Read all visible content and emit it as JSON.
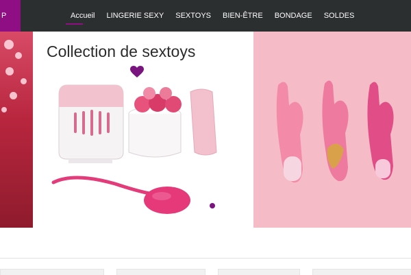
{
  "logo": {
    "label": "P"
  },
  "nav": {
    "items": [
      {
        "label": "Accueil",
        "active": true
      },
      {
        "label": "LINGERIE SEXY"
      },
      {
        "label": "SEXTOYS"
      },
      {
        "label": "BIEN-ÊTRE"
      },
      {
        "label": "BONDAGE"
      },
      {
        "label": "SOLDES"
      }
    ]
  },
  "hero": {
    "center_title": "Collection de sextoys"
  },
  "colors": {
    "navbar": "#2c2f30",
    "accent": "#8f0e83",
    "pink": "#f5bcc8"
  },
  "icons": [
    "heart-icon"
  ]
}
